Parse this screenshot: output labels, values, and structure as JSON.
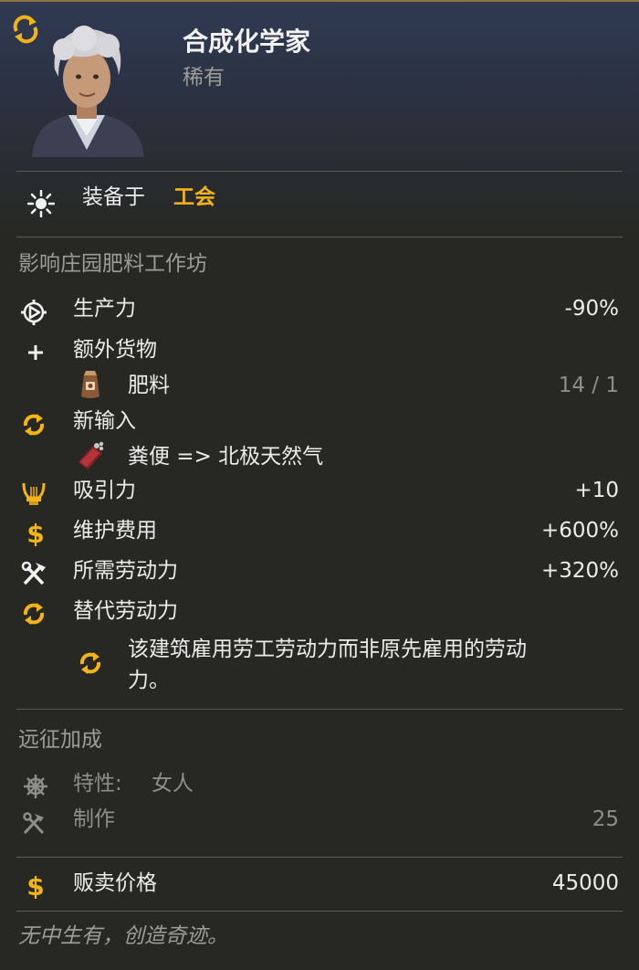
{
  "header": {
    "title": "合成化学家",
    "rarity": "稀有",
    "swap_icon": "refresh-icon",
    "portrait_icon": "specialist-portrait"
  },
  "equip": {
    "label": "装备于",
    "building": "工会",
    "icon": "sun-icon"
  },
  "effects": {
    "heading": "影响庄园肥料工作坊",
    "productivity": {
      "label": "生产力",
      "value": "-90%",
      "icon": "gear-icon"
    },
    "extra_goods": {
      "label": "额外货物",
      "icon": "plus-icon",
      "item": {
        "label": "肥料",
        "value": "14 / 1",
        "icon": "fertilizer-sack-icon"
      }
    },
    "new_input": {
      "label": "新输入",
      "icon": "cycle-icon",
      "item": {
        "label": "粪便 => 北极天然气",
        "icon": "manure-icon"
      }
    },
    "attractiveness": {
      "label": "吸引力",
      "value": "+10",
      "icon": "lyre-icon"
    },
    "maintenance": {
      "label": "维护费用",
      "value": "+600%",
      "icon": "dollar-icon"
    },
    "workforce": {
      "label": "所需劳动力",
      "value": "+320%",
      "icon": "tools-icon"
    },
    "replace_workforce": {
      "label": "替代劳动力",
      "icon": "cycle-icon",
      "desc_line1": "该建筑雇用劳工劳动力而非原先雇用的劳动",
      "desc_line2": "力。"
    }
  },
  "expedition": {
    "heading": "远征加成",
    "trait": {
      "label": "特性:",
      "value": "女人",
      "icon": "ship-wheel-icon"
    },
    "crafting": {
      "label": "制作",
      "value": "25",
      "icon": "crafting-tools-icon"
    }
  },
  "sell": {
    "label": "贩卖价格",
    "value": "45000",
    "icon": "dollar-icon"
  },
  "flavor": "无中生有，创造奇迹。",
  "colors": {
    "gold": "#f2b418",
    "background": "#272824",
    "header_blue": "#2f3a52"
  }
}
